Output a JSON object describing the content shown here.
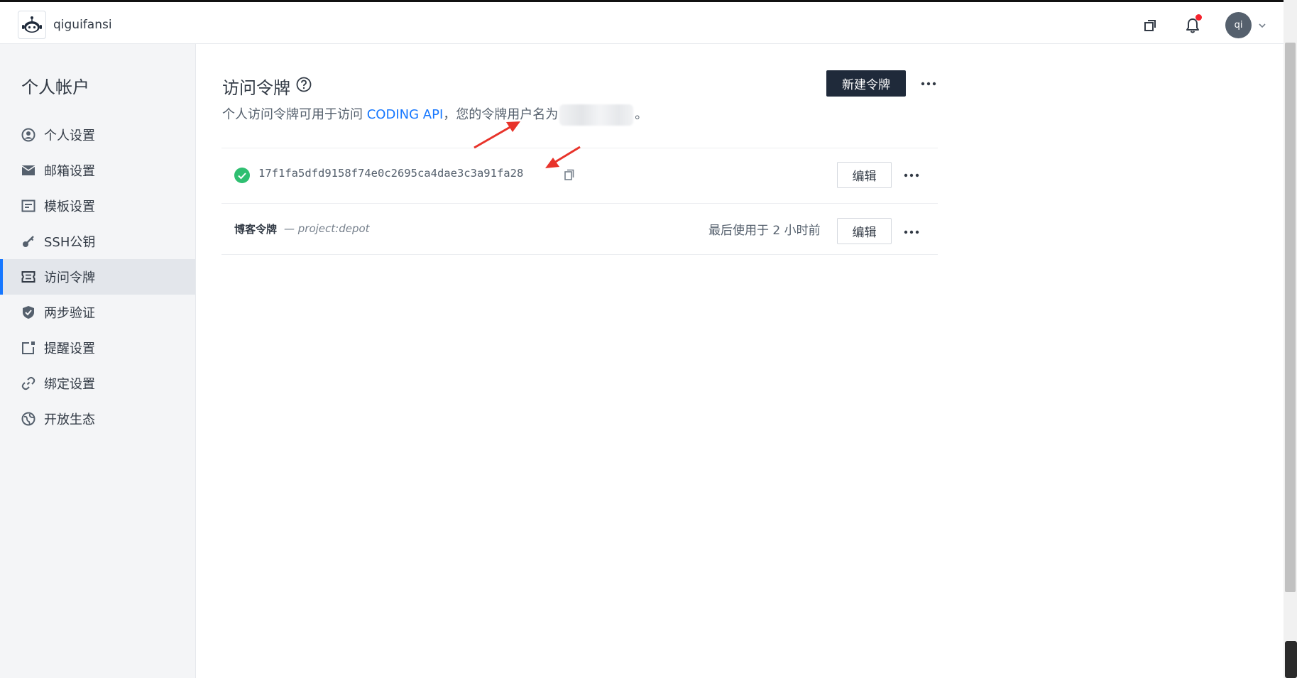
{
  "header": {
    "team_name": "qiguifansi",
    "avatar_initials": "qi",
    "notification_badge_color": "#f5222d"
  },
  "sidebar": {
    "title": "个人帐户",
    "items": [
      {
        "label": "个人设置",
        "icon": "user-circle-icon"
      },
      {
        "label": "邮箱设置",
        "icon": "mail-icon"
      },
      {
        "label": "模板设置",
        "icon": "template-icon"
      },
      {
        "label": "SSH公钥",
        "icon": "key-icon"
      },
      {
        "label": "访问令牌",
        "icon": "ticket-icon",
        "active": true
      },
      {
        "label": "两步验证",
        "icon": "shield-check-icon"
      },
      {
        "label": "提醒设置",
        "icon": "reminder-icon"
      },
      {
        "label": "绑定设置",
        "icon": "link-icon"
      },
      {
        "label": "开放生态",
        "icon": "globe-icon"
      }
    ]
  },
  "main": {
    "title": "访问令牌",
    "subtitle_prefix": "个人访问令牌可用于访问 ",
    "subtitle_link": "CODING API",
    "subtitle_middle": "，您的令牌用户名为",
    "subtitle_suffix": "。",
    "new_token_button": "新建令牌",
    "tokens": [
      {
        "value": "17f1fa5dfd9158f74e0c2695ca4dae3c3a91fa28",
        "status": "active",
        "edit_label": "编辑"
      },
      {
        "name": "博客令牌",
        "scope": "— project:depot",
        "last_used": "最后使用于 2 小时前",
        "edit_label": "编辑"
      }
    ]
  },
  "colors": {
    "accent": "#1677ff",
    "primary_button": "#1f2a3a",
    "success": "#2fbf71",
    "annotation_arrow": "#e8332a"
  }
}
